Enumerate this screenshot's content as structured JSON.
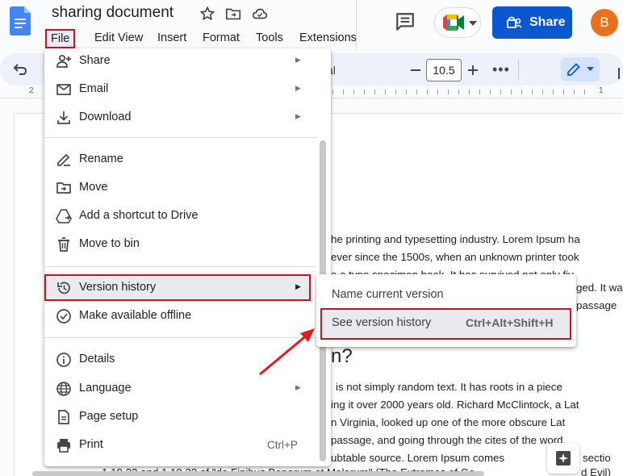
{
  "window": {
    "title": "sharing document"
  },
  "menubar": {
    "items": [
      "File",
      "Edit",
      "View",
      "Insert",
      "Format",
      "Tools",
      "Extensions"
    ]
  },
  "header": {
    "share_label": "Share",
    "avatar_letter": "B"
  },
  "toolbar": {
    "font_fragment": "al",
    "font_size": "10.5",
    "minus": "−",
    "plus": "+",
    "more": "•••"
  },
  "ruler": {
    "labels": [
      "2",
      "1"
    ]
  },
  "file_menu": {
    "items": [
      {
        "label": "Share",
        "icon": "person-add-icon",
        "submenu": true
      },
      {
        "label": "Email",
        "icon": "email-icon",
        "submenu": true
      },
      {
        "label": "Download",
        "icon": "download-icon",
        "submenu": true
      },
      {
        "label": "Rename",
        "icon": "rename-icon"
      },
      {
        "label": "Move",
        "icon": "move-icon"
      },
      {
        "label": "Add a shortcut to Drive",
        "icon": "drive-shortcut-icon"
      },
      {
        "label": "Move to bin",
        "icon": "trash-icon"
      },
      {
        "label": "Version history",
        "icon": "history-icon",
        "submenu": true
      },
      {
        "label": "Make available offline",
        "icon": "offline-icon"
      },
      {
        "label": "Details",
        "icon": "info-icon"
      },
      {
        "label": "Language",
        "icon": "globe-icon",
        "submenu": true
      },
      {
        "label": "Page setup",
        "icon": "page-icon"
      },
      {
        "label": "Print",
        "icon": "print-icon",
        "shortcut": "Ctrl+P"
      }
    ]
  },
  "version_submenu": {
    "name_current": "Name current version",
    "see_history": "See version history",
    "see_history_shortcut": "Ctrl+Alt+Shift+H"
  },
  "document": {
    "lines_top": [
      "he printing and typesetting industry. Lorem Ipsum ha",
      "ever since the 1500s, when an unknown printer took",
      "e a type specimen book. It has survived not only fiv",
      "ged. It wa",
      "passage"
    ],
    "heading_fragment": "n?",
    "lines_bottom": [
      "is not simply random text. It has roots in a piece",
      "ing it over 2000 years old. Richard McClintock, a Lat",
      "n Virginia, looked up one of the more obscure Lat",
      "passage, and going through the cites of the word",
      "ubtable source. Lorem Ipsum comes",
      "sectio",
      "1.10.32 and 1.10.33 of \"de Finibus Bonorum et Malorum\" (The Extremes of Go",
      "d Evil)"
    ]
  },
  "colors": {
    "annotation_red": "#d0101c",
    "share_blue": "#0b57d0",
    "avatar_orange": "#e8711c"
  }
}
